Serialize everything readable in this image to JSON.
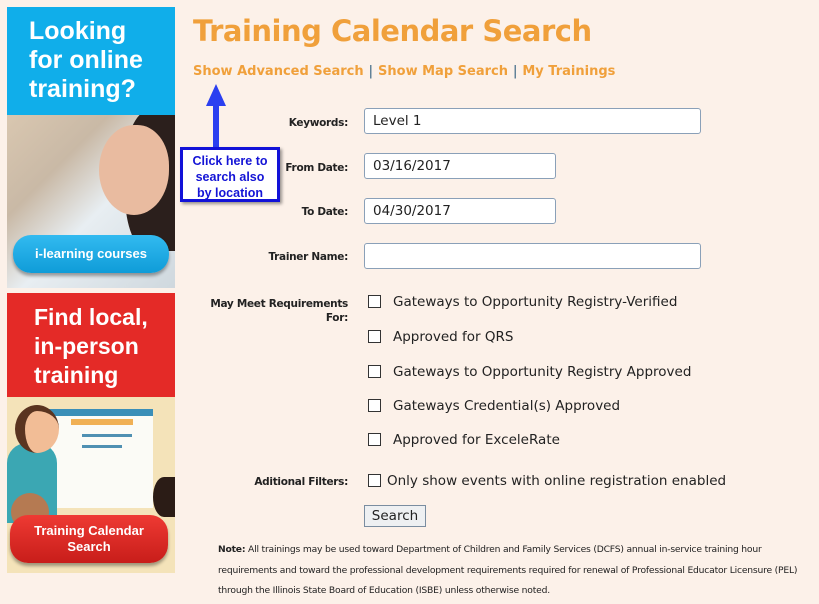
{
  "banners": {
    "online": {
      "heading_lines": [
        "Looking",
        "for online",
        "training?"
      ],
      "button_label": "i-learning courses",
      "color": "#10aeea"
    },
    "local": {
      "heading_lines": [
        "Find local,",
        "in-person",
        "training"
      ],
      "button_lines": [
        "Training Calendar",
        "Search"
      ],
      "color": "#e42a27"
    }
  },
  "header": {
    "title": "Training Calendar Search",
    "links": [
      {
        "label": "Show Advanced Search"
      },
      {
        "label": "Show Map Search"
      },
      {
        "label": "My Trainings"
      }
    ],
    "separator": "|",
    "accent_color": "#f0a03b"
  },
  "callout": {
    "lines": [
      "Click here to",
      "search also",
      "by location"
    ]
  },
  "form": {
    "keywords": {
      "label": "Keywords:",
      "value": "Level 1"
    },
    "from_date": {
      "label": "From Date:",
      "value": "03/16/2017"
    },
    "to_date": {
      "label": "To Date:",
      "value": "04/30/2017"
    },
    "trainer_name": {
      "label": "Trainer Name:",
      "value": ""
    },
    "requirements": {
      "label_lines": [
        "May Meet Requirements",
        "For:"
      ],
      "options": [
        {
          "label": "Gateways to Opportunity Registry-Verified",
          "checked": false
        },
        {
          "label": "Approved for QRS",
          "checked": false
        },
        {
          "label": "Gateways to Opportunity Registry Approved",
          "checked": false
        },
        {
          "label": "Gateways Credential(s) Approved",
          "checked": false
        },
        {
          "label": "Approved for ExceleRate",
          "checked": false
        }
      ]
    },
    "additional_filters": {
      "label": "Aditional Filters:",
      "options": [
        {
          "label": "Only show events with online registration enabled",
          "checked": false
        }
      ]
    },
    "search_button": "Search"
  },
  "note": {
    "prefix": "Note:",
    "text": " All trainings may be used toward Department of Children and Family Services (DCFS) annual in-service training hour requirements and toward the professional development requirements required for renewal of Professional Educator Licensure (PEL) through the Illinois State Board of Education (ISBE) unless otherwise noted."
  }
}
